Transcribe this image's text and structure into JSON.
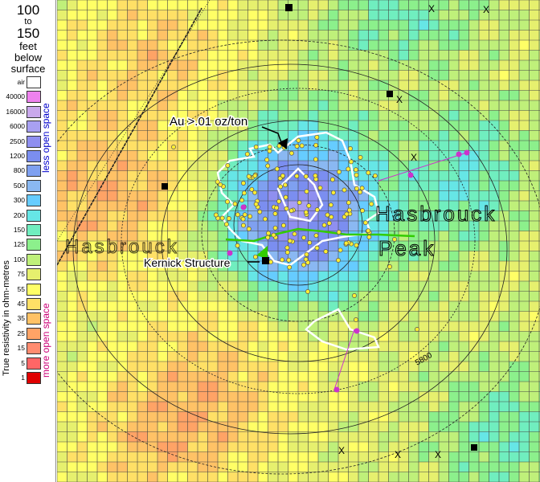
{
  "legend": {
    "depth_top": "100",
    "depth_to": "to",
    "depth_bottom": "150",
    "depth_line1": "feet",
    "depth_line2": "below",
    "depth_line3": "surface",
    "scale": [
      {
        "label": "air",
        "color": "#ffffff"
      },
      {
        "label": "40000",
        "color": "#ee82ee"
      },
      {
        "label": "16000",
        "color": "#c9a8ec"
      },
      {
        "label": "6000",
        "color": "#a8a0f2"
      },
      {
        "label": "2500",
        "color": "#8f8ff0"
      },
      {
        "label": "1200",
        "color": "#7b8ef0"
      },
      {
        "label": "800",
        "color": "#7fa0f0"
      },
      {
        "label": "500",
        "color": "#8ab8f2"
      },
      {
        "label": "300",
        "color": "#66ccff"
      },
      {
        "label": "200",
        "color": "#66e6e6"
      },
      {
        "label": "150",
        "color": "#70eebf"
      },
      {
        "label": "125",
        "color": "#8cf08c"
      },
      {
        "label": "100",
        "color": "#bff07a"
      },
      {
        "label": "75",
        "color": "#e6f06e"
      },
      {
        "label": "55",
        "color": "#ffff66"
      },
      {
        "label": "45",
        "color": "#ffe066"
      },
      {
        "label": "35",
        "color": "#ffc266"
      },
      {
        "label": "25",
        "color": "#ffa366"
      },
      {
        "label": "15",
        "color": "#ff8c70"
      },
      {
        "label": "5",
        "color": "#ff6666"
      },
      {
        "label": "1",
        "color": "#e00000"
      }
    ],
    "less_open": "less open space",
    "more_open": "more open space",
    "axis_title": "True resistivity in ohm-metres",
    "less_color": "#0000cc",
    "more_color": "#cc0077"
  },
  "map": {
    "label_gold": "Au >.01 oz/ton",
    "label_kernick": "Kernick Structure",
    "label_peak_1": "Hasbrouck",
    "label_peak_2": "Peak",
    "label_west": "Hasbrouck",
    "contour_label": "5800",
    "colors": {
      "gold_outline": "#ffffff",
      "structure_line": "#33cc00",
      "sample_point": "#ffee33",
      "drill_point": "#cc33cc"
    }
  }
}
